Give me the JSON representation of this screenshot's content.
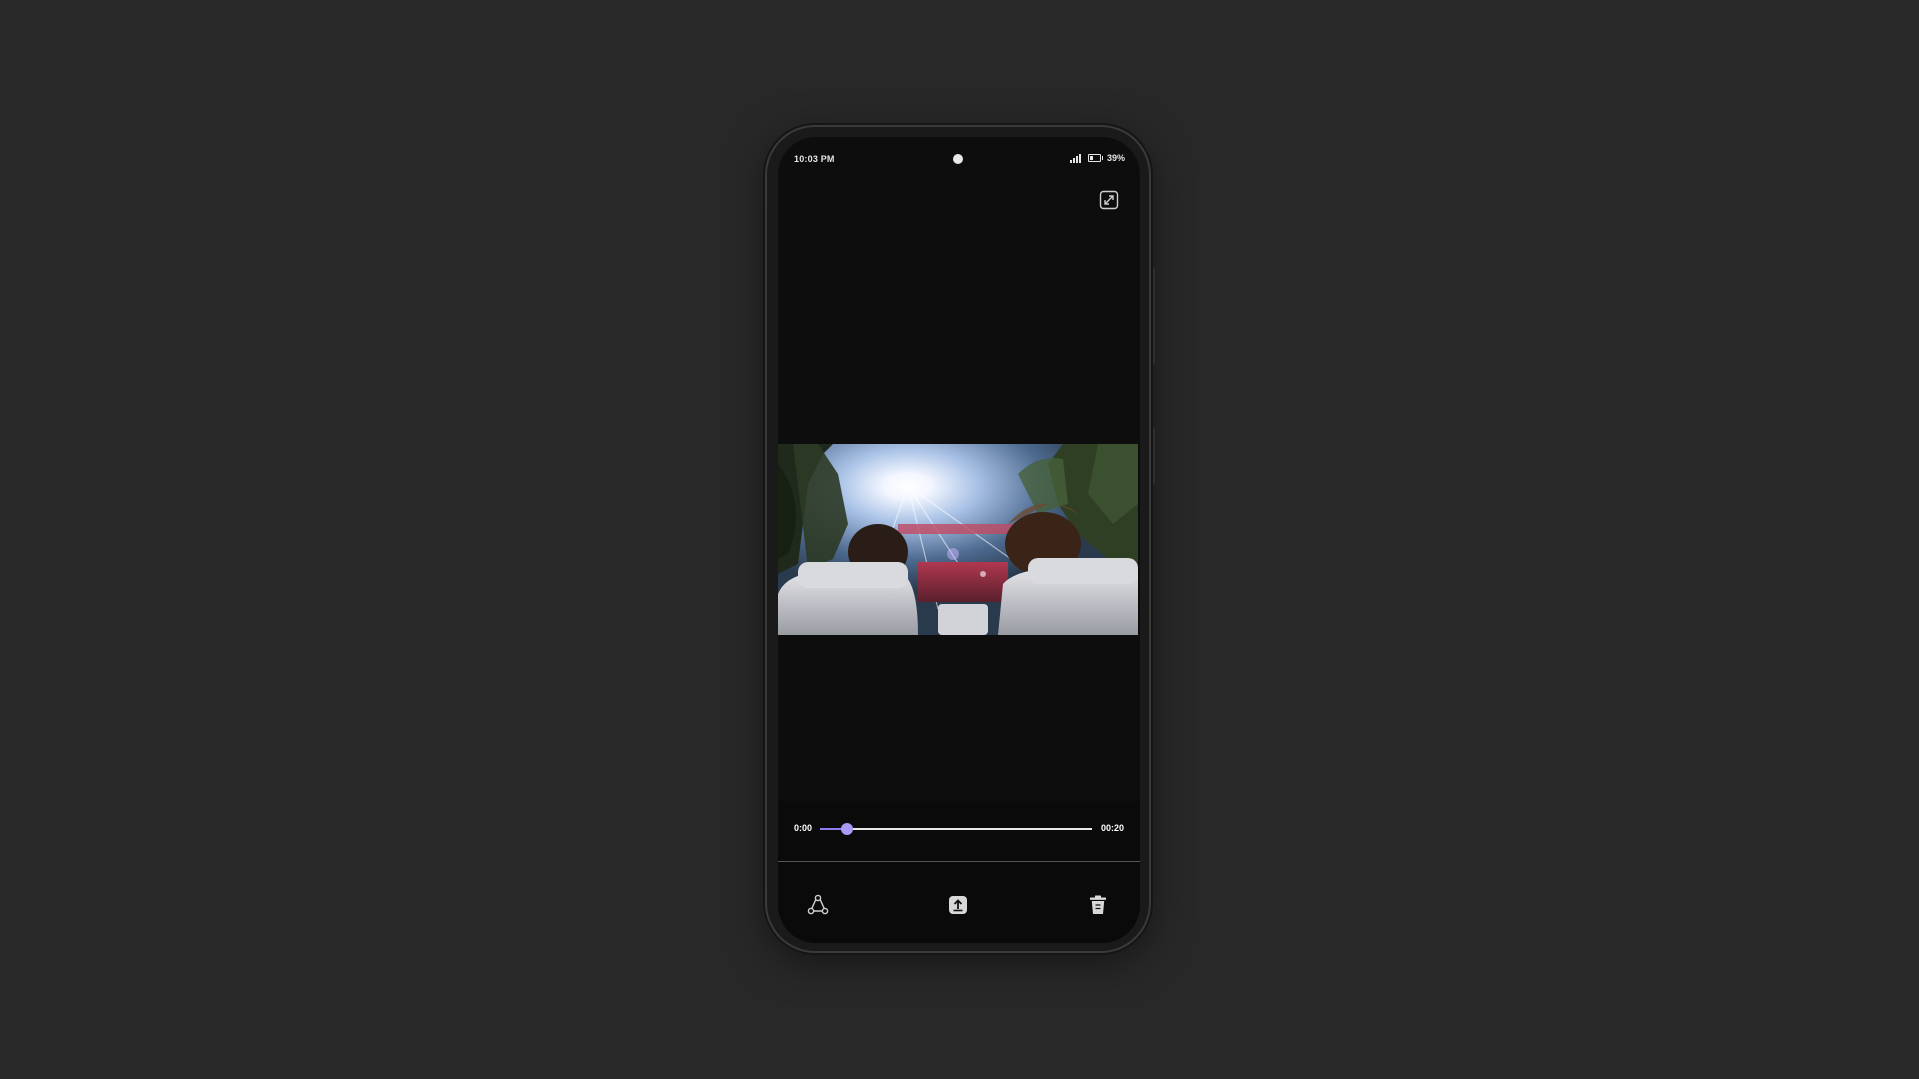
{
  "status_bar": {
    "time": "10:03 PM",
    "battery_percent": "39%",
    "signal_bars": 4,
    "battery_level": 0.39
  },
  "toolbar": {
    "expand_icon": "expand-diagonal-icon"
  },
  "video": {
    "description_icon": "video-frame",
    "scene": "two people in convertible car seats driving under trees toward the sun"
  },
  "player": {
    "current_time": "0:00",
    "duration": "00:20",
    "progress": 0.1,
    "accent_color": "#8a7cf0"
  },
  "bottom_bar": {
    "share_icon": "share-icon",
    "upload_icon": "upload-icon",
    "delete_icon": "trash-icon"
  },
  "colors": {
    "background": "#282828",
    "screen": "#0d0d0d",
    "accent": "#8a7cf0"
  }
}
